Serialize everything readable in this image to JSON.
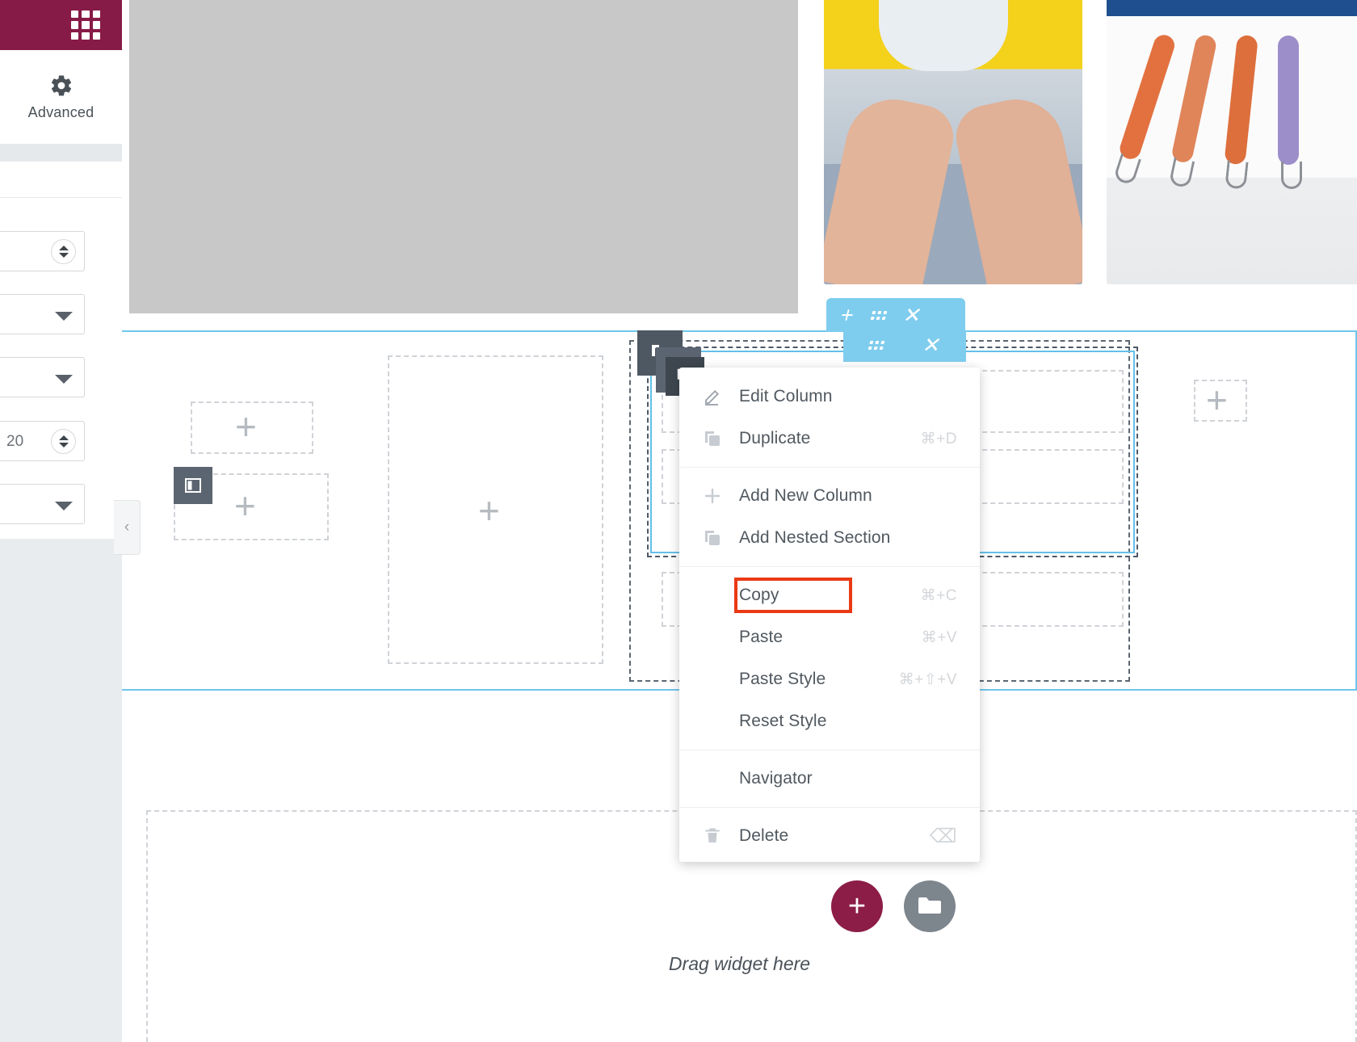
{
  "app": {
    "accent_maroon": "#871B47",
    "accent_blue": "#6ec6ed",
    "highlight_red": "#ea3a14"
  },
  "left_panel": {
    "header": {
      "apps_icon": "apps-grid-icon"
    },
    "tab": {
      "icon": "gear-icon",
      "label": "Advanced"
    },
    "controls": [
      {
        "name": "numeric-stepper-1",
        "type": "number",
        "value": "",
        "icon": "stepper-icon"
      },
      {
        "name": "select-1",
        "type": "select",
        "value": "",
        "icon": "chevron-down-icon"
      },
      {
        "name": "select-2",
        "type": "select",
        "value": "",
        "icon": "chevron-down-icon"
      },
      {
        "name": "numeric-stepper-2",
        "type": "number",
        "value": "20",
        "icon": "stepper-icon"
      },
      {
        "name": "select-3",
        "type": "select",
        "value": "",
        "icon": "chevron-down-icon"
      }
    ],
    "collapse_glyph": "‹"
  },
  "context_menu": {
    "items": [
      {
        "label": "Edit Column",
        "shortcut": "",
        "icon": "pencil-icon",
        "separator_after": true
      },
      {
        "label": "Duplicate",
        "shortcut": "⌘+D",
        "icon": "duplicate-icon",
        "separator_after": true
      },
      {
        "label": "Add New Column",
        "shortcut": "",
        "icon": "plus-icon",
        "separator_after": false
      },
      {
        "label": "Add Nested Section",
        "shortcut": "",
        "icon": "nested-section-icon",
        "separator_after": true
      },
      {
        "label": "Copy",
        "shortcut": "⌘+C",
        "icon": "",
        "separator_after": false,
        "highlighted": true
      },
      {
        "label": "Paste",
        "shortcut": "⌘+V",
        "icon": "",
        "separator_after": false
      },
      {
        "label": "Paste Style",
        "shortcut": "⌘+⇧+V",
        "icon": "",
        "separator_after": false
      },
      {
        "label": "Reset Style",
        "shortcut": "",
        "icon": "",
        "separator_after": true
      },
      {
        "label": "Navigator",
        "shortcut": "",
        "icon": "",
        "separator_after": true
      },
      {
        "label": "Delete",
        "shortcut": "⌫",
        "icon": "trash-icon",
        "separator_after": false
      }
    ]
  },
  "canvas": {
    "placeholder_plus": "+",
    "section_handle": {
      "add_icon": "plus-icon",
      "drag_icon": "dots-grid-icon",
      "close_icon": "close-icon"
    },
    "column_handle_icon": "column-handle-icon",
    "edit_chip_icon": "column-layout-icon"
  },
  "bottom": {
    "add_button_label": "+",
    "add_button_name": "add-new-section-button",
    "folder_button_name": "template-library-button",
    "drag_hint": "Drag widget here"
  }
}
